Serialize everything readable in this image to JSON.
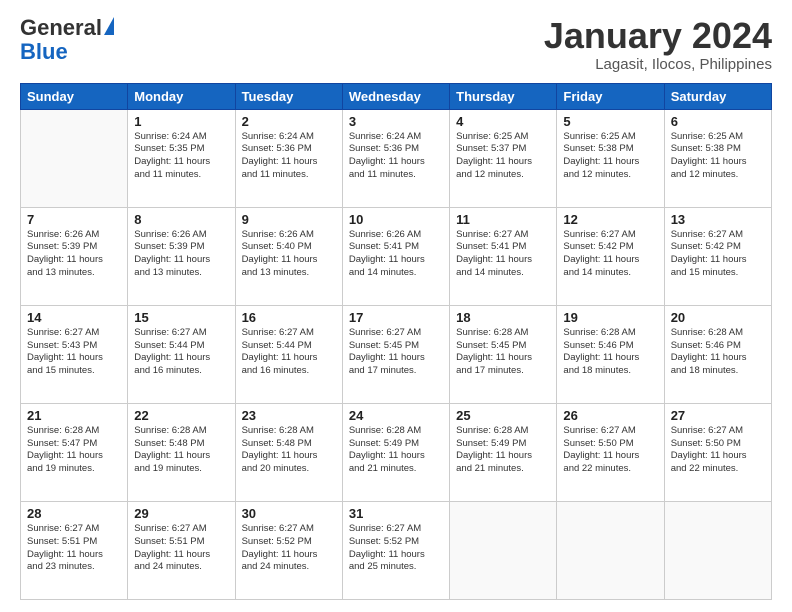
{
  "header": {
    "logo_general": "General",
    "logo_blue": "Blue",
    "month_title": "January 2024",
    "subtitle": "Lagasit, Ilocos, Philippines"
  },
  "weekdays": [
    "Sunday",
    "Monday",
    "Tuesday",
    "Wednesday",
    "Thursday",
    "Friday",
    "Saturday"
  ],
  "weeks": [
    [
      {
        "day": "",
        "empty": true
      },
      {
        "day": "1",
        "sunrise": "6:24 AM",
        "sunset": "5:35 PM",
        "daylight": "11 hours and 11 minutes."
      },
      {
        "day": "2",
        "sunrise": "6:24 AM",
        "sunset": "5:36 PM",
        "daylight": "11 hours and 11 minutes."
      },
      {
        "day": "3",
        "sunrise": "6:24 AM",
        "sunset": "5:36 PM",
        "daylight": "11 hours and 11 minutes."
      },
      {
        "day": "4",
        "sunrise": "6:25 AM",
        "sunset": "5:37 PM",
        "daylight": "11 hours and 12 minutes."
      },
      {
        "day": "5",
        "sunrise": "6:25 AM",
        "sunset": "5:38 PM",
        "daylight": "11 hours and 12 minutes."
      },
      {
        "day": "6",
        "sunrise": "6:25 AM",
        "sunset": "5:38 PM",
        "daylight": "11 hours and 12 minutes."
      }
    ],
    [
      {
        "day": "7",
        "sunrise": "6:26 AM",
        "sunset": "5:39 PM",
        "daylight": "11 hours and 13 minutes."
      },
      {
        "day": "8",
        "sunrise": "6:26 AM",
        "sunset": "5:39 PM",
        "daylight": "11 hours and 13 minutes."
      },
      {
        "day": "9",
        "sunrise": "6:26 AM",
        "sunset": "5:40 PM",
        "daylight": "11 hours and 13 minutes."
      },
      {
        "day": "10",
        "sunrise": "6:26 AM",
        "sunset": "5:41 PM",
        "daylight": "11 hours and 14 minutes."
      },
      {
        "day": "11",
        "sunrise": "6:27 AM",
        "sunset": "5:41 PM",
        "daylight": "11 hours and 14 minutes."
      },
      {
        "day": "12",
        "sunrise": "6:27 AM",
        "sunset": "5:42 PM",
        "daylight": "11 hours and 14 minutes."
      },
      {
        "day": "13",
        "sunrise": "6:27 AM",
        "sunset": "5:42 PM",
        "daylight": "11 hours and 15 minutes."
      }
    ],
    [
      {
        "day": "14",
        "sunrise": "6:27 AM",
        "sunset": "5:43 PM",
        "daylight": "11 hours and 15 minutes."
      },
      {
        "day": "15",
        "sunrise": "6:27 AM",
        "sunset": "5:44 PM",
        "daylight": "11 hours and 16 minutes."
      },
      {
        "day": "16",
        "sunrise": "6:27 AM",
        "sunset": "5:44 PM",
        "daylight": "11 hours and 16 minutes."
      },
      {
        "day": "17",
        "sunrise": "6:27 AM",
        "sunset": "5:45 PM",
        "daylight": "11 hours and 17 minutes."
      },
      {
        "day": "18",
        "sunrise": "6:28 AM",
        "sunset": "5:45 PM",
        "daylight": "11 hours and 17 minutes."
      },
      {
        "day": "19",
        "sunrise": "6:28 AM",
        "sunset": "5:46 PM",
        "daylight": "11 hours and 18 minutes."
      },
      {
        "day": "20",
        "sunrise": "6:28 AM",
        "sunset": "5:46 PM",
        "daylight": "11 hours and 18 minutes."
      }
    ],
    [
      {
        "day": "21",
        "sunrise": "6:28 AM",
        "sunset": "5:47 PM",
        "daylight": "11 hours and 19 minutes."
      },
      {
        "day": "22",
        "sunrise": "6:28 AM",
        "sunset": "5:48 PM",
        "daylight": "11 hours and 19 minutes."
      },
      {
        "day": "23",
        "sunrise": "6:28 AM",
        "sunset": "5:48 PM",
        "daylight": "11 hours and 20 minutes."
      },
      {
        "day": "24",
        "sunrise": "6:28 AM",
        "sunset": "5:49 PM",
        "daylight": "11 hours and 21 minutes."
      },
      {
        "day": "25",
        "sunrise": "6:28 AM",
        "sunset": "5:49 PM",
        "daylight": "11 hours and 21 minutes."
      },
      {
        "day": "26",
        "sunrise": "6:27 AM",
        "sunset": "5:50 PM",
        "daylight": "11 hours and 22 minutes."
      },
      {
        "day": "27",
        "sunrise": "6:27 AM",
        "sunset": "5:50 PM",
        "daylight": "11 hours and 22 minutes."
      }
    ],
    [
      {
        "day": "28",
        "sunrise": "6:27 AM",
        "sunset": "5:51 PM",
        "daylight": "11 hours and 23 minutes."
      },
      {
        "day": "29",
        "sunrise": "6:27 AM",
        "sunset": "5:51 PM",
        "daylight": "11 hours and 24 minutes."
      },
      {
        "day": "30",
        "sunrise": "6:27 AM",
        "sunset": "5:52 PM",
        "daylight": "11 hours and 24 minutes."
      },
      {
        "day": "31",
        "sunrise": "6:27 AM",
        "sunset": "5:52 PM",
        "daylight": "11 hours and 25 minutes."
      },
      {
        "day": "",
        "empty": true
      },
      {
        "day": "",
        "empty": true
      },
      {
        "day": "",
        "empty": true
      }
    ]
  ]
}
